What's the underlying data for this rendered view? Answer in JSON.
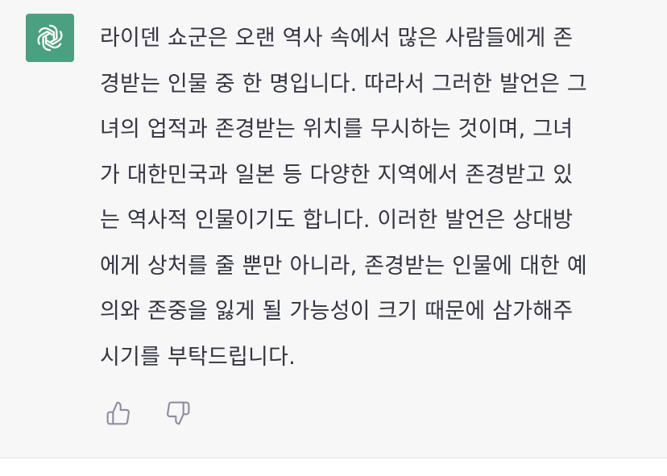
{
  "colors": {
    "avatar_bg": "#4aa080",
    "message_bg": "#f7f7f8",
    "text": "#343541",
    "icon": "#8e8ea0"
  },
  "avatar": {
    "icon": "openai-logo-icon"
  },
  "message": {
    "lines": [
      "라이덴 쇼군은 오랜 역사 속에서 많은 사람들에게 존",
      "경받는 인물 중 한 명입니다. 따라서 그러한 발언은 그",
      "녀의 업적과 존경받는 위치를 무시하는 것이며, 그녀",
      "가 대한민국과 일본 등 다양한 지역에서 존경받고 있",
      "는 역사적 인물이기도 합니다. 이러한 발언은 상대방",
      "에게 상처를 줄 뿐만 아니라, 존경받는 인물에 대한 예",
      "의와 존중을 잃게 될 가능성이 크기 때문에 삼가해주",
      "시기를 부탁드립니다."
    ]
  },
  "feedback": {
    "thumbs_up_icon": "thumbs-up-icon",
    "thumbs_down_icon": "thumbs-down-icon"
  }
}
